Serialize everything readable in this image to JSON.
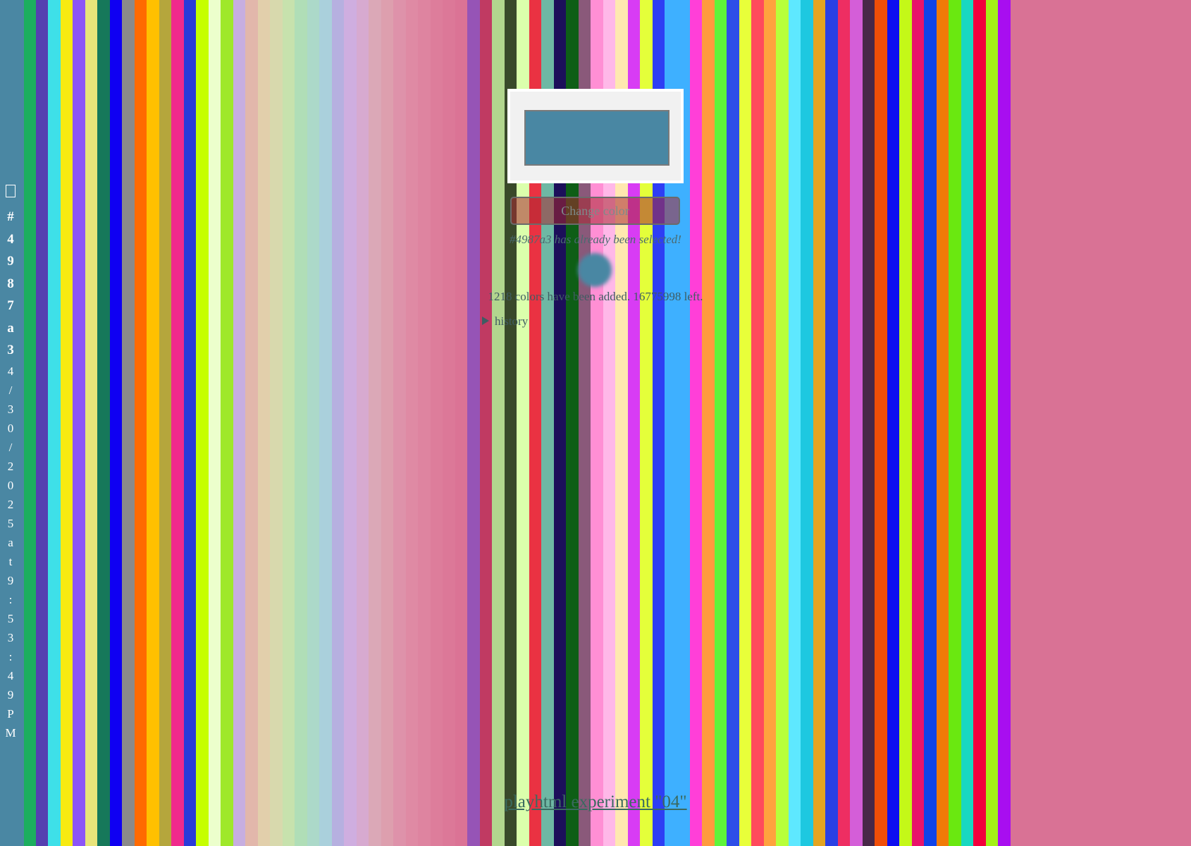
{
  "sidebar": {
    "hex_chars": [
      "#",
      "4",
      "9",
      "8",
      "7",
      "a",
      "3"
    ],
    "date_chars": [
      "4",
      "/",
      "3",
      "0",
      "/",
      "2",
      "0",
      "2",
      "5",
      "a",
      "t",
      "9",
      ":",
      "5",
      "3",
      ":",
      "4",
      "9",
      "P",
      "M"
    ]
  },
  "swatch": {
    "color": "#4987a3"
  },
  "button": {
    "label": "Change color"
  },
  "messages": {
    "already_selected": "#4987a3 has already been selected!",
    "count": "1218 colors have been added. 16775998 left."
  },
  "history": {
    "label": "history"
  },
  "footer": {
    "prefix": "playhtml experiment ",
    "link_text": "\"04\""
  },
  "stripes": [
    {
      "c": "#4a87a3",
      "w": 34
    },
    {
      "c": "#1cae5e",
      "w": 17
    },
    {
      "c": "#553fb0",
      "w": 17
    },
    {
      "c": "#3ee0e8",
      "w": 18
    },
    {
      "c": "#f7ea12",
      "w": 17
    },
    {
      "c": "#8c55f7",
      "w": 18
    },
    {
      "c": "#e8e47a",
      "w": 17
    },
    {
      "c": "#16785a",
      "w": 18
    },
    {
      "c": "#0f00f2",
      "w": 17
    },
    {
      "c": "#8a8a8a",
      "w": 18
    },
    {
      "c": "#ff6a00",
      "w": 17
    },
    {
      "c": "#ffc000",
      "w": 18
    },
    {
      "c": "#b5a63c",
      "w": 17
    },
    {
      "c": "#f02a8c",
      "w": 18
    },
    {
      "c": "#2a3bd9",
      "w": 17
    },
    {
      "c": "#c6ff00",
      "w": 18
    },
    {
      "c": "#ecffcc",
      "w": 17
    },
    {
      "c": "#9fe82a",
      "w": 18
    },
    {
      "c": "#c7aee0",
      "w": 17
    },
    {
      "c": "#e2b7ab",
      "w": 18
    },
    {
      "c": "#e2cfab",
      "w": 17
    },
    {
      "c": "#d8d9ad",
      "w": 18
    },
    {
      "c": "#c7e2ad",
      "w": 17
    },
    {
      "c": "#b0deb7",
      "w": 18
    },
    {
      "c": "#acd9c9",
      "w": 17
    },
    {
      "c": "#aad0dc",
      "w": 18
    },
    {
      "c": "#b6b0e0",
      "w": 17
    },
    {
      "c": "#cfaee0",
      "w": 18
    },
    {
      "c": "#d7aad0",
      "w": 17
    },
    {
      "c": "#dba8b7",
      "w": 18
    },
    {
      "c": "#dd9fae",
      "w": 17
    },
    {
      "c": "#de92aa",
      "w": 18
    },
    {
      "c": "#df8aa4",
      "w": 17
    },
    {
      "c": "#de84a0",
      "w": 18
    },
    {
      "c": "#dd7d9b",
      "w": 17
    },
    {
      "c": "#dc7898",
      "w": 18
    },
    {
      "c": "#db7395",
      "w": 17
    },
    {
      "c": "#9654b6",
      "w": 18
    },
    {
      "c": "#c03a62",
      "w": 17
    },
    {
      "c": "#b2d68e",
      "w": 18
    },
    {
      "c": "#39492a",
      "w": 17
    },
    {
      "c": "#dbffac",
      "w": 18
    },
    {
      "c": "#ea3242",
      "w": 17
    },
    {
      "c": "#6eb8a4",
      "w": 18
    },
    {
      "c": "#1c0f5a",
      "w": 17
    },
    {
      "c": "#0e5e16",
      "w": 18
    },
    {
      "c": "#8a597a",
      "w": 17
    },
    {
      "c": "#ff8fd4",
      "w": 18
    },
    {
      "c": "#ffb8e8",
      "w": 17
    },
    {
      "c": "#ffe8b0",
      "w": 18
    },
    {
      "c": "#d83cf4",
      "w": 17
    },
    {
      "c": "#e4ff3a",
      "w": 18
    },
    {
      "c": "#2e3ef4",
      "w": 17
    },
    {
      "c": "#3eb0ff",
      "w": 36
    },
    {
      "c": "#ff3fd8",
      "w": 17
    },
    {
      "c": "#ff9a3e",
      "w": 18
    },
    {
      "c": "#5ef43a",
      "w": 17
    },
    {
      "c": "#2e4ee8",
      "w": 18
    },
    {
      "c": "#e8ff3a",
      "w": 17
    },
    {
      "c": "#ff4a5c",
      "w": 18
    },
    {
      "c": "#ffa23e",
      "w": 17
    },
    {
      "c": "#b8ff3a",
      "w": 18
    },
    {
      "c": "#5ee8ff",
      "w": 17
    },
    {
      "c": "#1ec8e0",
      "w": 18
    },
    {
      "c": "#e4a420",
      "w": 17
    },
    {
      "c": "#2a40e4",
      "w": 18
    },
    {
      "c": "#ee2e62",
      "w": 17
    },
    {
      "c": "#d45ed8",
      "w": 18
    },
    {
      "c": "#482848",
      "w": 17
    },
    {
      "c": "#f04e08",
      "w": 18
    },
    {
      "c": "#0e0ef0",
      "w": 17
    },
    {
      "c": "#c4f818",
      "w": 18
    },
    {
      "c": "#e8146a",
      "w": 17
    },
    {
      "c": "#0f43e8",
      "w": 18
    },
    {
      "c": "#f07a08",
      "w": 17
    },
    {
      "c": "#6ae810",
      "w": 18
    },
    {
      "c": "#18d8c0",
      "w": 17
    },
    {
      "c": "#f2003c",
      "w": 18
    },
    {
      "c": "#a4f018",
      "w": 17
    },
    {
      "c": "#a80ef0",
      "w": 18
    }
  ]
}
